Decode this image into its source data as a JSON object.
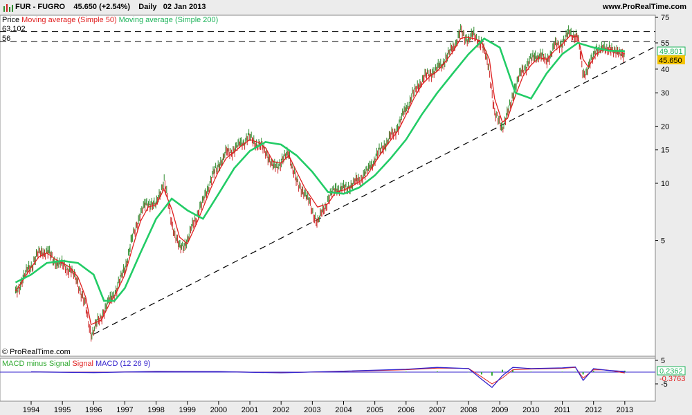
{
  "header": {
    "symbol": "FUR - FUGRO",
    "price": "45.650",
    "change": "(+2.54%)",
    "period": "Daily",
    "date": "02 Jan 2013",
    "site": "www.ProRealTime.com"
  },
  "legend": {
    "price_label": "Price",
    "ma50_label": "Moving average (Simple 50)",
    "ma200_label": "Moving average (Simple 200)"
  },
  "levels": {
    "high_label": "63.102",
    "mid_label": "56"
  },
  "copyright": "© ProRealTime.com",
  "macd_legend": {
    "hist_label": "MACD minus Signal",
    "signal_label": "Signal",
    "macd_label": "MACD (12 26 9)"
  },
  "right_labels": {
    "ma200_value": "49.801",
    "last_price": "45.650",
    "macd_value": "0.2362",
    "signal_value": "-0.3763"
  },
  "colors": {
    "price_up": "#2e8b2e",
    "price_down": "#cc2222",
    "ma50": "#e02020",
    "ma200": "#22cc66",
    "macd": "#3322cc",
    "signal": "#e02020",
    "hist": "#33aa33",
    "last_price_bg": "#f5c400"
  },
  "chart_data": [
    {
      "type": "line",
      "scale": "log",
      "x_ticks": [
        "1994",
        "1995",
        "1996",
        "1997",
        "1998",
        "1999",
        "2000",
        "2001",
        "2002",
        "2003",
        "2004",
        "2005",
        "2006",
        "2007",
        "2008",
        "2009",
        "2010",
        "2011",
        "2012",
        "2013"
      ],
      "y_ticks": [
        "75",
        "55",
        "40",
        "30",
        "20",
        "15",
        "10",
        "5"
      ],
      "series": [
        {
          "name": "Price",
          "x": [
            "1993-07",
            "1993-10",
            "1994-01",
            "1994-04",
            "1994-07",
            "1994-10",
            "1995-01",
            "1995-04",
            "1995-07",
            "1995-10",
            "1995-12",
            "1996-04",
            "1996-07",
            "1996-10",
            "1997-01",
            "1997-04",
            "1997-07",
            "1997-10",
            "1998-01",
            "1998-04",
            "1998-07",
            "1998-10",
            "1999-01",
            "1999-04",
            "1999-07",
            "1999-10",
            "2000-01",
            "2000-04",
            "2000-07",
            "2000-10",
            "2001-01",
            "2001-04",
            "2001-07",
            "2001-10",
            "2002-01",
            "2002-04",
            "2002-07",
            "2002-10",
            "2003-03",
            "2003-07",
            "2003-10",
            "2004-01",
            "2004-04",
            "2004-07",
            "2004-10",
            "2005-01",
            "2005-04",
            "2005-07",
            "2005-10",
            "2006-01",
            "2006-04",
            "2006-07",
            "2006-10",
            "2007-01",
            "2007-04",
            "2007-07",
            "2007-10",
            "2007-12",
            "2008-03",
            "2008-06",
            "2008-09",
            "2008-11",
            "2009-02",
            "2009-04",
            "2009-07",
            "2009-10",
            "2010-01",
            "2010-04",
            "2010-07",
            "2010-10",
            "2011-01",
            "2011-04",
            "2011-07",
            "2011-09",
            "2011-11",
            "2012-02",
            "2012-04",
            "2012-07",
            "2012-09",
            "2012-11",
            "2013-01"
          ],
          "values": [
            2.6,
            3.2,
            3.7,
            4.3,
            4.4,
            3.9,
            3.7,
            3.5,
            3.0,
            2.2,
            1.6,
            2.0,
            2.4,
            2.8,
            3.6,
            5.2,
            7.0,
            8.0,
            7.6,
            10.5,
            6.2,
            4.5,
            5.0,
            6.5,
            8.0,
            10.5,
            12.5,
            14.5,
            15.0,
            16.5,
            17.5,
            16.0,
            15.0,
            12.0,
            13.0,
            14.5,
            10.0,
            9.0,
            6.2,
            8.2,
            9.5,
            9.3,
            9.8,
            10.5,
            11.5,
            13.5,
            15.5,
            17.5,
            20.0,
            25.0,
            30.0,
            35.0,
            38.0,
            40.0,
            45.0,
            52.0,
            63.0,
            58.0,
            60.0,
            55.0,
            40.0,
            23.0,
            20.0,
            23.0,
            33.0,
            40.0,
            45.0,
            48.0,
            44.0,
            53.0,
            55.0,
            63.0,
            58.0,
            38.0,
            40.0,
            52.0,
            50.0,
            53.0,
            48.0,
            51.0,
            45.65
          ]
        },
        {
          "name": "Moving average (Simple 50)",
          "x": [
            "1993-07",
            "1993-10",
            "1994-01",
            "1994-04",
            "1994-07",
            "1994-10",
            "1995-01",
            "1995-04",
            "1995-07",
            "1995-10",
            "1995-12",
            "1996-04",
            "1996-07",
            "1996-10",
            "1997-01",
            "1997-04",
            "1997-07",
            "1997-10",
            "1998-01",
            "1998-04",
            "1998-07",
            "1998-10",
            "1999-01",
            "1999-04",
            "1999-07",
            "1999-10",
            "2000-01",
            "2000-04",
            "2000-07",
            "2000-10",
            "2001-01",
            "2001-04",
            "2001-07",
            "2001-10",
            "2002-01",
            "2002-04",
            "2002-07",
            "2002-10",
            "2003-03",
            "2003-07",
            "2003-10",
            "2004-01",
            "2004-04",
            "2004-07",
            "2004-10",
            "2005-01",
            "2005-04",
            "2005-07",
            "2005-10",
            "2006-01",
            "2006-04",
            "2006-07",
            "2006-10",
            "2007-01",
            "2007-04",
            "2007-07",
            "2007-10",
            "2007-12",
            "2008-03",
            "2008-06",
            "2008-09",
            "2008-11",
            "2009-02",
            "2009-04",
            "2009-07",
            "2009-10",
            "2010-01",
            "2010-04",
            "2010-07",
            "2010-10",
            "2011-01",
            "2011-04",
            "2011-07",
            "2011-09",
            "2011-11",
            "2012-02",
            "2012-04",
            "2012-07",
            "2012-09",
            "2012-11",
            "2013-01"
          ],
          "values": [
            2.7,
            3.1,
            3.6,
            4.1,
            4.3,
            4.0,
            3.8,
            3.6,
            3.2,
            2.5,
            1.8,
            1.9,
            2.3,
            2.7,
            3.3,
            4.6,
            6.3,
            7.5,
            7.7,
            9.3,
            7.3,
            5.2,
            4.8,
            5.9,
            7.4,
            9.4,
            11.6,
            13.6,
            14.6,
            15.9,
            17.0,
            16.5,
            15.4,
            13.0,
            12.8,
            14.0,
            11.5,
            9.5,
            7.5,
            7.8,
            9.0,
            9.2,
            9.6,
            10.2,
            11.0,
            12.8,
            14.8,
            16.8,
            19.0,
            23.0,
            28.0,
            33.0,
            36.5,
            39.0,
            43.5,
            49.5,
            58.0,
            59.0,
            58.0,
            56.0,
            45.0,
            28.0,
            21.0,
            22.0,
            29.0,
            37.0,
            42.0,
            46.0,
            45.0,
            50.0,
            54.0,
            60.0,
            59.0,
            45.0,
            41.0,
            48.0,
            50.0,
            51.0,
            50.0,
            50.0,
            48.0
          ]
        },
        {
          "name": "Moving average (Simple 200)",
          "x": [
            "1993-07",
            "1994-01",
            "1994-07",
            "1995-01",
            "1995-07",
            "1996-01",
            "1996-05",
            "1996-09",
            "1997-01",
            "1997-07",
            "1998-01",
            "1998-07",
            "1999-01",
            "1999-07",
            "2000-01",
            "2000-07",
            "2001-01",
            "2001-07",
            "2002-01",
            "2002-07",
            "2003-01",
            "2003-07",
            "2004-01",
            "2004-07",
            "2005-01",
            "2005-07",
            "2006-01",
            "2006-07",
            "2007-01",
            "2007-07",
            "2008-01",
            "2008-07",
            "2009-01",
            "2009-07",
            "2010-01",
            "2010-07",
            "2011-01",
            "2011-07",
            "2012-01",
            "2012-07",
            "2013-01"
          ],
          "values": [
            3.0,
            3.3,
            3.8,
            3.9,
            3.8,
            3.3,
            2.4,
            2.4,
            2.8,
            4.3,
            6.5,
            8.3,
            7.2,
            6.5,
            8.8,
            12.0,
            14.8,
            16.5,
            16.0,
            14.0,
            11.5,
            9.0,
            8.8,
            9.5,
            11.0,
            13.5,
            17.0,
            23.0,
            30.0,
            38.0,
            48.0,
            58.0,
            52.0,
            30.0,
            28.0,
            38.0,
            48.0,
            55.0,
            52.0,
            50.0,
            49.8
          ]
        }
      ],
      "annotations": [
        {
          "label": "63.102",
          "y": 63.102,
          "style": "dashed"
        },
        {
          "label": "56",
          "y": 56,
          "style": "dashed"
        },
        {
          "label": "trend line",
          "x": [
            "1996-01",
            "2013-12"
          ],
          "y": [
            1.6,
            52
          ],
          "style": "dashed"
        }
      ],
      "grid": false
    },
    {
      "type": "line",
      "title": "MACD (12 26 9)",
      "y_ticks": [
        "5",
        "-5"
      ],
      "series": [
        {
          "name": "MACD",
          "x": [
            "1994",
            "1996",
            "1998",
            "2000",
            "2002",
            "2004",
            "2006",
            "2007",
            "2008",
            "2008-06",
            "2008-10",
            "2009-02",
            "2009-06",
            "2010",
            "2011",
            "2011-06",
            "2011-09",
            "2012",
            "2012-06",
            "2013"
          ],
          "values": [
            0.1,
            -0.2,
            0.3,
            0.2,
            -0.3,
            0.4,
            1.2,
            2.0,
            1.5,
            -3.0,
            -6.5,
            -1.5,
            2.0,
            1.5,
            1.8,
            2.2,
            -3.5,
            1.5,
            0.8,
            0.24
          ]
        },
        {
          "name": "Signal",
          "x": [
            "1994",
            "1996",
            "1998",
            "2000",
            "2002",
            "2004",
            "2006",
            "2007",
            "2008",
            "2008-06",
            "2008-10",
            "2009-02",
            "2009-06",
            "2010",
            "2011",
            "2011-06",
            "2011-09",
            "2012",
            "2012-06",
            "2013"
          ],
          "values": [
            0.1,
            -0.1,
            0.2,
            0.2,
            -0.2,
            0.3,
            1.0,
            1.7,
            1.6,
            -2.0,
            -5.0,
            -2.5,
            1.0,
            1.3,
            1.6,
            2.0,
            -2.5,
            1.0,
            0.9,
            -0.38
          ]
        }
      ],
      "grid": false
    }
  ]
}
